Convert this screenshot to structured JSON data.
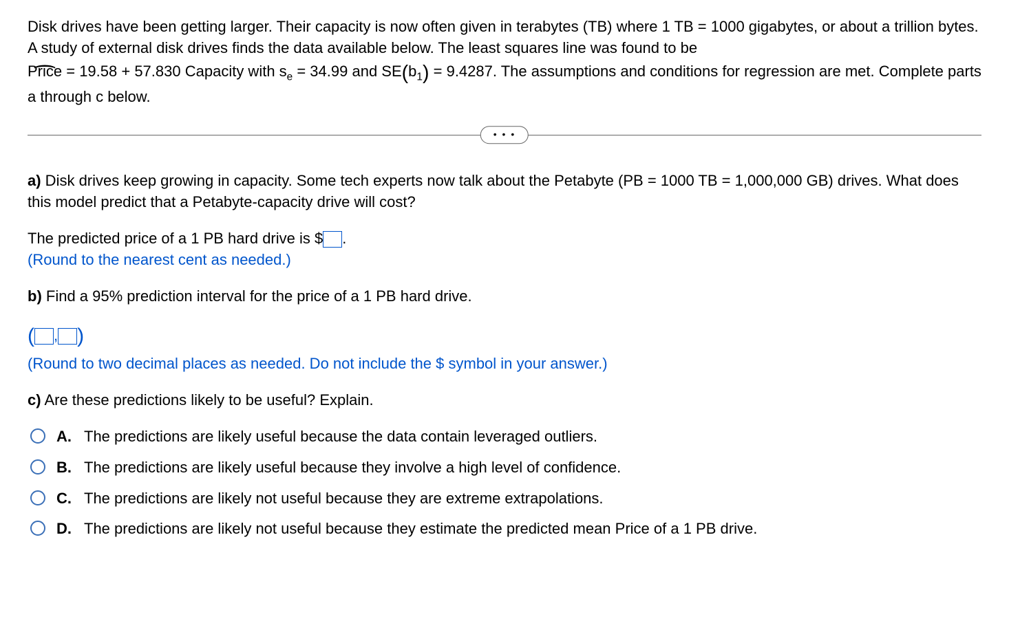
{
  "intro": {
    "line1": "Disk drives have been getting larger. Their capacity is now often given in terabytes (TB) where 1 TB = 1000 gigabytes, or about a trillion bytes. A study of external disk drives finds the data available below. The least squares line was found to be",
    "price_label": "Price",
    "equation_pre": " = 19.58 + 57.830 Capacity with s",
    "equation_sub1": "e",
    "equation_mid": " = 34.99 and SE",
    "equation_b": "b",
    "equation_b_sub": "1",
    "equation_post": " = 9.4287. The assumptions and conditions for regression are met. Complete parts a through c below."
  },
  "part_a": {
    "label": "a)",
    "text": " Disk drives keep growing in capacity. Some tech experts now talk about the Petabyte (PB = 1000 TB = 1,000,000 GB) drives. What does this model predict that a Petabyte-capacity drive will cost?",
    "predicted_prefix": "The predicted price of a 1 PB hard drive is $",
    "predicted_suffix": ".",
    "round_note": "(Round to the nearest cent as needed.)"
  },
  "part_b": {
    "label": "b)",
    "text": " Find a 95% prediction interval for the price of a 1 PB hard drive.",
    "comma": ",",
    "round_note": "(Round to two decimal places as needed. Do not include the $ symbol in your answer.)"
  },
  "part_c": {
    "label": "c)",
    "text": " Are these predictions likely to be useful? Explain.",
    "options": [
      {
        "letter": "A.",
        "text": "The predictions are likely useful because the data contain leveraged outliers."
      },
      {
        "letter": "B.",
        "text": "The predictions are likely useful because they involve a high level of confidence."
      },
      {
        "letter": "C.",
        "text": "The predictions are likely not useful because they are extreme extrapolations."
      },
      {
        "letter": "D.",
        "text": "The predictions are likely not useful because they estimate the predicted mean Price of a 1 PB drive."
      }
    ]
  },
  "ellipsis": "• • •"
}
